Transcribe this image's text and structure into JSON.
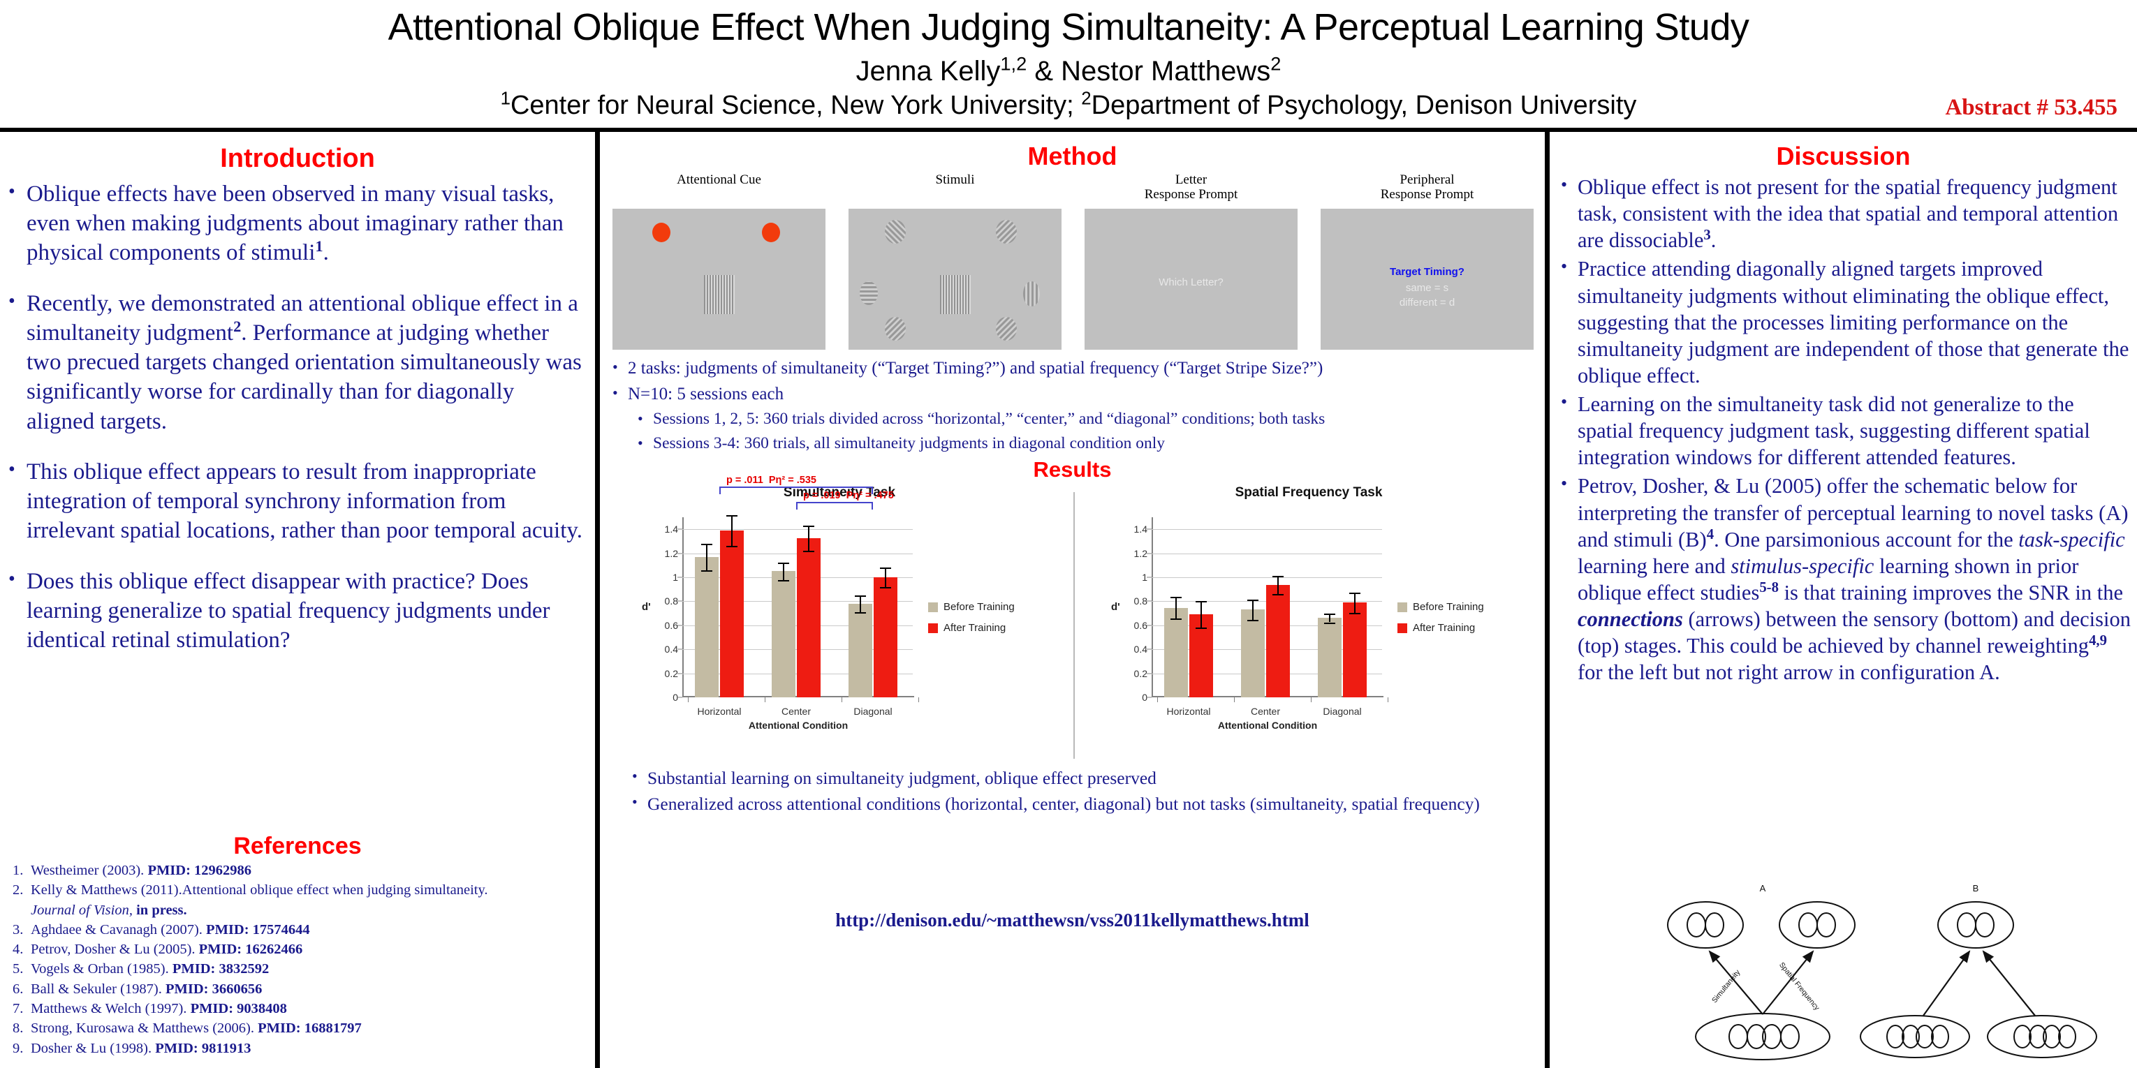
{
  "header": {
    "title": "Attentional Oblique Effect When Judging Simultaneity: A Perceptual Learning Study",
    "authors_main": "Jenna Kelly",
    "authors_sup1": "1,2",
    "authors_amp": " & Nestor Matthews",
    "authors_sup2": "2",
    "affil_sup1": "1",
    "affil_part1": "Center for Neural Science, New York University; ",
    "affil_sup2": "2",
    "affil_part2": "Department of Psychology, Denison University",
    "abstract_number": "Abstract # 53.455"
  },
  "introduction": {
    "heading": "Introduction",
    "bullets": [
      {
        "text_a": "Oblique effects have been observed in many visual tasks, even when making judgments about imaginary rather than physical components of stimuli",
        "sup": "1",
        "text_b": "."
      },
      {
        "text_a": "Recently, we demonstrated an attentional oblique effect in a simultaneity judgment",
        "sup": "2",
        "text_b": ".  Performance at judging whether two precued targets changed orientation simultaneously was significantly worse for cardinally than for diagonally aligned targets."
      },
      {
        "text_a": "This oblique effect appears to result from inappropriate integration of temporal synchrony information from irrelevant spatial locations, rather than poor temporal acuity.",
        "sup": "",
        "text_b": ""
      },
      {
        "text_a": "Does this oblique effect disappear with practice? Does learning generalize to spatial frequency judgments under identical retinal stimulation?",
        "sup": "",
        "text_b": ""
      }
    ]
  },
  "references": {
    "heading": "References",
    "items": [
      {
        "num": "1.",
        "text": "Westheimer (2003). ",
        "bold": "PMID: 12962986",
        "tail": ""
      },
      {
        "num": "2.",
        "text": "Kelly & Matthews (2011).Attentional oblique effect when judging simultaneity.",
        "bold": "",
        "tail": "",
        "cont_italic": "Journal of Vision,",
        "cont_bold": " in press."
      },
      {
        "num": "3.",
        "text": "Aghdaee & Cavanagh (2007). ",
        "bold": "PMID: 17574644",
        "tail": ""
      },
      {
        "num": "4.",
        "text": "Petrov, Dosher & Lu (2005). ",
        "bold": "PMID: 16262466",
        "tail": ""
      },
      {
        "num": "5.",
        "text": "Vogels & Orban (1985). ",
        "bold": "PMID: 3832592",
        "tail": ""
      },
      {
        "num": "6.",
        "text": "Ball & Sekuler (1987). ",
        "bold": "PMID: 3660656",
        "tail": ""
      },
      {
        "num": "7.",
        "text": "Matthews & Welch (1997). ",
        "bold": "PMID: 9038408",
        "tail": ""
      },
      {
        "num": "8.",
        "text": "Strong, Kurosawa & Matthews (2006). ",
        "bold": "PMID: 16881797",
        "tail": ""
      },
      {
        "num": "9.",
        "text": "Dosher & Lu (1998). ",
        "bold": "PMID: 9811913",
        "tail": ""
      }
    ]
  },
  "method": {
    "heading": "Method",
    "panels": [
      {
        "caption_line1": "",
        "caption_line2": "Attentional Cue"
      },
      {
        "caption_line1": "",
        "caption_line2": "Stimuli"
      },
      {
        "caption_line1": "Letter",
        "caption_line2": "Response Prompt"
      },
      {
        "caption_line1": "Peripheral",
        "caption_line2": "Response Prompt"
      }
    ],
    "letter_prompt_text": "Which Letter?",
    "peripheral_prompt_title": "Target Timing?",
    "peripheral_prompt_line1": "same = s",
    "peripheral_prompt_line2": "different  = d",
    "bullets": [
      "2 tasks: judgments of simultaneity (“Target Timing?”) and spatial frequency (“Target Stripe Size?”)",
      "N=10:  5 sessions each"
    ],
    "subbullets": [
      "Sessions 1, 2, 5: 360 trials divided across “horizontal,”  “center,” and “diagonal” conditions; both tasks",
      "Sessions 3-4: 360 trials, all simultaneity judgments in diagonal condition only"
    ]
  },
  "results": {
    "heading": "Results",
    "bullets": [
      "Substantial learning on simultaneity judgment, oblique effect preserved",
      "Generalized across attentional conditions (horizontal, center, diagonal) but not tasks (simultaneity, spatial frequency)"
    ],
    "url": "http://denison.edu/~matthewsn/vss2011kellymatthews.html"
  },
  "chart_data": [
    {
      "type": "bar",
      "title": "Simultaneity Task",
      "xlabel": "Attentional Condition",
      "ylabel": "d'",
      "categories": [
        "Horizontal",
        "Center",
        "Diagonal"
      ],
      "ylim": [
        0,
        1.5
      ],
      "yticks": [
        0,
        0.2,
        0.4,
        0.6,
        0.8,
        1,
        1.2,
        1.4
      ],
      "ytick_labels": [
        "0",
        "0.2",
        "0.4",
        "0.6",
        "0.8",
        "1",
        "1.2",
        "1.4"
      ],
      "grid": true,
      "legend_position": "right",
      "series": [
        {
          "name": "Before Training",
          "color": "#c3bba3",
          "values": [
            1.17,
            1.05,
            0.78
          ],
          "errors": [
            0.11,
            0.075,
            0.07
          ]
        },
        {
          "name": "After Training",
          "color": "#ee1c12",
          "values": [
            1.39,
            1.325,
            1.0
          ],
          "errors": [
            0.13,
            0.105,
            0.08
          ]
        }
      ],
      "annotations": [
        {
          "text_p": "p = .011",
          "text_eta": "Pη² = .535",
          "spans": [
            "Horizontal",
            "Diagonal"
          ]
        },
        {
          "text_p": "p = .019",
          "text_eta": "Pη² = .475",
          "spans": [
            "Center",
            "Diagonal"
          ]
        }
      ]
    },
    {
      "type": "bar",
      "title": "Spatial Frequency Task",
      "xlabel": "Attentional Condition",
      "ylabel": "d'",
      "categories": [
        "Horizontal",
        "Center",
        "Diagonal"
      ],
      "ylim": [
        0,
        1.5
      ],
      "yticks": [
        0,
        0.2,
        0.4,
        0.6,
        0.8,
        1,
        1.2,
        1.4
      ],
      "ytick_labels": [
        "0",
        "0.2",
        "0.4",
        "0.6",
        "0.8",
        "1",
        "1.2",
        "1.4"
      ],
      "grid": true,
      "legend_position": "right",
      "series": [
        {
          "name": "Before Training",
          "color": "#c3bba3",
          "values": [
            0.745,
            0.73,
            0.66
          ],
          "errors": [
            0.09,
            0.085,
            0.035
          ]
        },
        {
          "name": "After Training",
          "color": "#ee1c12",
          "values": [
            0.69,
            0.935,
            0.79
          ],
          "errors": [
            0.11,
            0.075,
            0.085
          ]
        }
      ],
      "annotations": []
    }
  ],
  "discussion": {
    "heading": "Discussion",
    "bullets": [
      {
        "text_a": "Oblique effect is not present for the spatial frequency judgment task, consistent with the idea that spatial and temporal attention are dissociable",
        "sup": "3",
        "text_b": "."
      },
      {
        "text_a": "Practice attending diagonally aligned targets improved simultaneity judgments without eliminating the oblique effect, suggesting that the processes limiting performance on the simultaneity judgment are independent of those that generate the oblique effect.",
        "sup": "",
        "text_b": ""
      },
      {
        "text_a": "Learning on the simultaneity task did not generalize to the spatial frequency judgment task, suggesting different spatial integration windows for different attended features.",
        "sup": "",
        "text_b": ""
      }
    ],
    "last_bullet": {
      "p1": "Petrov, Dosher, & Lu (2005) offer the schematic below for interpreting the transfer of perceptual learning to novel tasks (A) and stimuli (B)",
      "sup1": "4",
      "p2": ". One parsimonious account for the ",
      "it1": "task-specific",
      "p3": " learning here and ",
      "it2": "stimulus-specific",
      "p4": " learning shown in prior oblique effect studies",
      "sup2": "5-8",
      "p5": " is that training improves the SNR in the ",
      "bi1": "connections",
      "p6": " (arrows) between the sensory (bottom) and decision (top) stages. This could be achieved by channel reweighting",
      "sup3": "4,9",
      "p7": " for the left but not right arrow in configuration A."
    }
  },
  "schematic": {
    "label_a": "A",
    "label_b": "B",
    "arrow_label_left": "Simultaneity",
    "arrow_label_right": "Spatial Frequency"
  },
  "colors": {
    "accent_red": "#ff0000",
    "abstract_red": "#d81414",
    "body_blue": "#1a1a8c",
    "bar_before": "#c3bba3",
    "bar_after": "#ee1c12",
    "annotation_red": "#e60000",
    "bracket_blue": "#4444cc",
    "panel_gray": "#c0c0c0",
    "cue_orange": "#f23b0c"
  }
}
